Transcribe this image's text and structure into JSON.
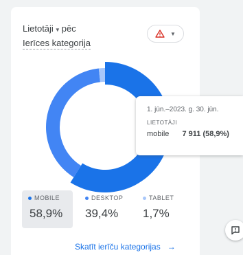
{
  "card": {
    "title_line1": "Lietotāji",
    "title_line2_suffix": "pēc",
    "title_line3": "Ierīces kategorija",
    "warning_icon": "warning-triangle-icon",
    "link_label": "Skatīt ierīču kategorijas",
    "link_arrow": "→"
  },
  "colors": {
    "mobile": "#1a73e8",
    "desktop": "#4285f4",
    "tablet": "#a8c7fa",
    "warning": "#d93025"
  },
  "chart_data": {
    "type": "pie",
    "categories": [
      "MOBILE",
      "DESKTOP",
      "TABLET"
    ],
    "values": [
      58.9,
      39.4,
      1.7
    ],
    "value_labels": [
      "58,9%",
      "39,4%",
      "1,7%"
    ],
    "legend": "bottom"
  },
  "tooltip": {
    "date_range": "1. jūn.–2023. g. 30. jūn.",
    "metric": "LIETOTĀJI",
    "category": "mobile",
    "value": "7 911 (58,9%)"
  }
}
